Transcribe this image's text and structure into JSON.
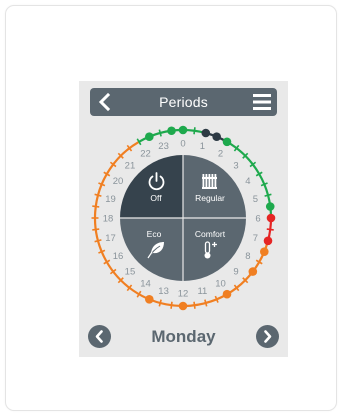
{
  "header": {
    "title": "Periods"
  },
  "footer": {
    "day": "Monday"
  },
  "modes": [
    {
      "id": "off",
      "label": "Off",
      "icon": "power-icon"
    },
    {
      "id": "regular",
      "label": "Regular",
      "icon": "radiator-icon"
    },
    {
      "id": "eco",
      "label": "Eco",
      "icon": "leaf-icon"
    },
    {
      "id": "comfort",
      "label": "Comfort",
      "icon": "thermometer-plus-icon"
    }
  ],
  "hours": [
    "0",
    "1",
    "2",
    "3",
    "4",
    "5",
    "6",
    "7",
    "8",
    "9",
    "10",
    "11",
    "12",
    "13",
    "14",
    "15",
    "16",
    "17",
    "18",
    "19",
    "20",
    "21",
    "22",
    "23"
  ],
  "colors": {
    "eco": "#f07f22",
    "regular": "#1ea94d",
    "off": "#2d3a44",
    "comfort": "#e52524",
    "dial_dark": "#36434d",
    "dial_mid": "#5b6770",
    "header": "#5b6770"
  },
  "segments": [
    {
      "from": 0,
      "to": 1,
      "mode": "regular"
    },
    {
      "from": 1,
      "to": 2,
      "mode": "off"
    },
    {
      "from": 2,
      "to": 6,
      "mode": "regular"
    },
    {
      "from": 6,
      "to": 7,
      "mode": "comfort"
    },
    {
      "from": 7,
      "to": 22,
      "mode": "eco"
    },
    {
      "from": 22,
      "to": 24,
      "mode": "regular"
    }
  ],
  "markers": [
    {
      "hour": 0,
      "mode": "regular"
    },
    {
      "hour": 1,
      "mode": "off"
    },
    {
      "hour": 1.5,
      "mode": "off"
    },
    {
      "hour": 2,
      "mode": "regular"
    },
    {
      "hour": 5.5,
      "mode": "regular"
    },
    {
      "hour": 6,
      "mode": "comfort"
    },
    {
      "hour": 7,
      "mode": "comfort"
    },
    {
      "hour": 7.5,
      "mode": "eco"
    },
    {
      "hour": 8.5,
      "mode": "eco"
    },
    {
      "hour": 10,
      "mode": "eco"
    },
    {
      "hour": 12,
      "mode": "eco"
    },
    {
      "hour": 13.5,
      "mode": "eco"
    },
    {
      "hour": 22.5,
      "mode": "regular"
    },
    {
      "hour": 23.5,
      "mode": "regular"
    }
  ]
}
